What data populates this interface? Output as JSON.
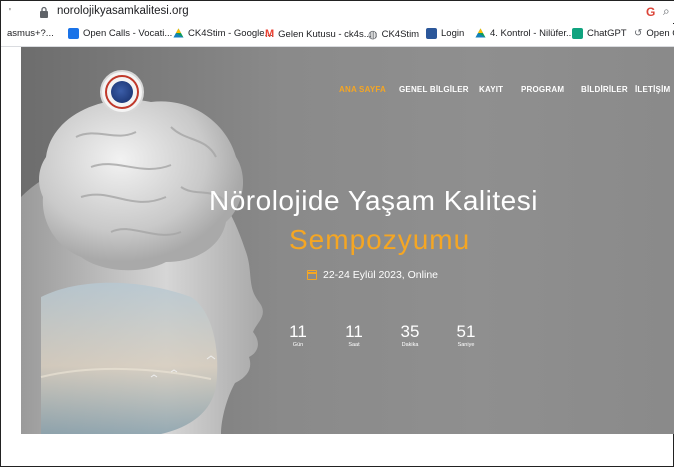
{
  "browser": {
    "url": "norolojikyasamkalitesi.org",
    "bookmarks": [
      {
        "label": "asmus+?...",
        "color": ""
      },
      {
        "label": "Open Calls - Vocati...",
        "color": "#1a73e8"
      },
      {
        "label": "CK4Stim - Google...",
        "color": "#0f9d58"
      },
      {
        "label": "Gelen Kutusu - ck4s...",
        "color": "#ea4335"
      },
      {
        "label": "CK4Stim",
        "color": "#5f6368"
      },
      {
        "label": "Login",
        "color": "#2b579a"
      },
      {
        "label": "4. Kontrol - Nilüfer...",
        "color": "#0f9d58"
      },
      {
        "label": "ChatGPT",
        "color": "#10a37f"
      },
      {
        "label": "Open Ca",
        "color": "#5f6368"
      }
    ]
  },
  "nav": {
    "items": [
      "ANA SAYFA",
      "GENEL BİLGİLER",
      "KAYIT",
      "PROGRAM",
      "BİLDİRİLER",
      "İLETİŞİM"
    ],
    "active_index": 0,
    "active_color": "#f5a623"
  },
  "hero": {
    "title_line1": "Nörolojide Yaşam Kalitesi",
    "title_line2": "Sempozyumu",
    "date_text": "22-24 Eylül 2023, Online",
    "accent_color": "#f5a623"
  },
  "countdown": [
    {
      "value": "11",
      "label": "Gün"
    },
    {
      "value": "11",
      "label": "Saat"
    },
    {
      "value": "35",
      "label": "Dakika"
    },
    {
      "value": "51",
      "label": "Saniye"
    }
  ]
}
